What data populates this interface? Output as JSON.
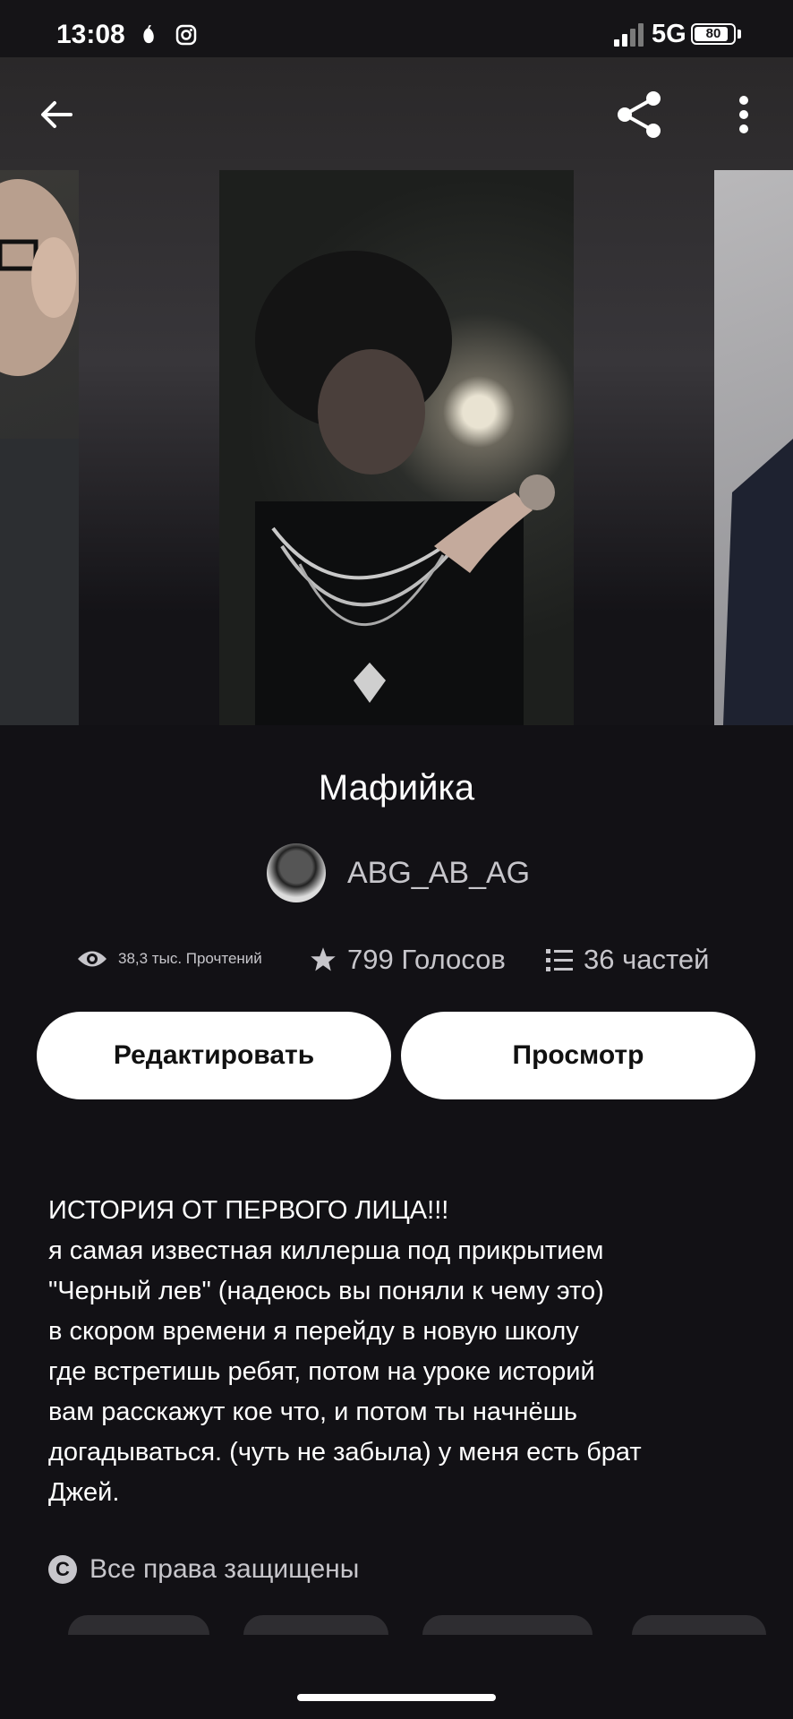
{
  "status_bar": {
    "time": "13:08",
    "network": "5G",
    "battery": "80"
  },
  "toolbar": {
    "back_icon": "arrow-left-icon",
    "share_icon": "share-icon",
    "more_icon": "more-vertical-icon"
  },
  "story": {
    "title": "Мафийка",
    "author": "ABG_AB_AG",
    "stats": {
      "reads": "38,3 тыс. Прочтений",
      "votes": "799 Голосов",
      "parts": "36 частей"
    },
    "buttons": {
      "edit": "Редактировать",
      "view": "Просмотр"
    },
    "description": "ИСТОРИЯ ОТ ПЕРВОГО ЛИЦА!!!\nя самая известная киллерша под прикрытием\n\"Черный лев\" (надеюсь вы поняли к чему это)\nв скором времени я перейду в новую школу\nгде встретишь ребят, потом на уроке историй\nвам расскажут кое что, и потом ты начнёшь\nдогадываться. (чуть не забыла) у меня есть брат\nДжей.",
    "copyright": "Все права защищены"
  },
  "colors": {
    "background": "#121115",
    "button_bg": "#ffffff",
    "secondary_text": "#c7c6cb"
  }
}
